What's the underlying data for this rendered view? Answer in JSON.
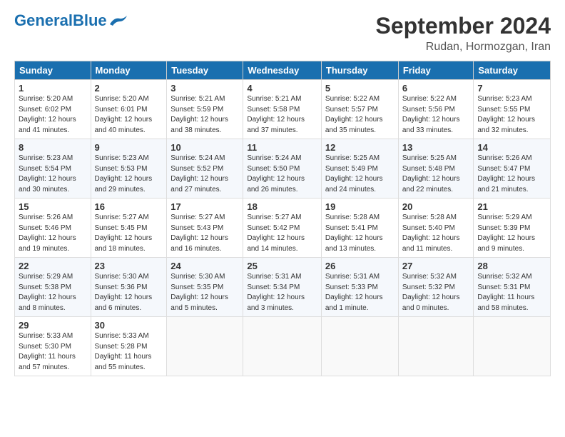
{
  "logo": {
    "text_general": "General",
    "text_blue": "Blue"
  },
  "header": {
    "month": "September 2024",
    "location": "Rudan, Hormozgan, Iran"
  },
  "weekdays": [
    "Sunday",
    "Monday",
    "Tuesday",
    "Wednesday",
    "Thursday",
    "Friday",
    "Saturday"
  ],
  "weeks": [
    [
      {
        "day": "1",
        "info": "Sunrise: 5:20 AM\nSunset: 6:02 PM\nDaylight: 12 hours\nand 41 minutes."
      },
      {
        "day": "2",
        "info": "Sunrise: 5:20 AM\nSunset: 6:01 PM\nDaylight: 12 hours\nand 40 minutes."
      },
      {
        "day": "3",
        "info": "Sunrise: 5:21 AM\nSunset: 5:59 PM\nDaylight: 12 hours\nand 38 minutes."
      },
      {
        "day": "4",
        "info": "Sunrise: 5:21 AM\nSunset: 5:58 PM\nDaylight: 12 hours\nand 37 minutes."
      },
      {
        "day": "5",
        "info": "Sunrise: 5:22 AM\nSunset: 5:57 PM\nDaylight: 12 hours\nand 35 minutes."
      },
      {
        "day": "6",
        "info": "Sunrise: 5:22 AM\nSunset: 5:56 PM\nDaylight: 12 hours\nand 33 minutes."
      },
      {
        "day": "7",
        "info": "Sunrise: 5:23 AM\nSunset: 5:55 PM\nDaylight: 12 hours\nand 32 minutes."
      }
    ],
    [
      {
        "day": "8",
        "info": "Sunrise: 5:23 AM\nSunset: 5:54 PM\nDaylight: 12 hours\nand 30 minutes."
      },
      {
        "day": "9",
        "info": "Sunrise: 5:23 AM\nSunset: 5:53 PM\nDaylight: 12 hours\nand 29 minutes."
      },
      {
        "day": "10",
        "info": "Sunrise: 5:24 AM\nSunset: 5:52 PM\nDaylight: 12 hours\nand 27 minutes."
      },
      {
        "day": "11",
        "info": "Sunrise: 5:24 AM\nSunset: 5:50 PM\nDaylight: 12 hours\nand 26 minutes."
      },
      {
        "day": "12",
        "info": "Sunrise: 5:25 AM\nSunset: 5:49 PM\nDaylight: 12 hours\nand 24 minutes."
      },
      {
        "day": "13",
        "info": "Sunrise: 5:25 AM\nSunset: 5:48 PM\nDaylight: 12 hours\nand 22 minutes."
      },
      {
        "day": "14",
        "info": "Sunrise: 5:26 AM\nSunset: 5:47 PM\nDaylight: 12 hours\nand 21 minutes."
      }
    ],
    [
      {
        "day": "15",
        "info": "Sunrise: 5:26 AM\nSunset: 5:46 PM\nDaylight: 12 hours\nand 19 minutes."
      },
      {
        "day": "16",
        "info": "Sunrise: 5:27 AM\nSunset: 5:45 PM\nDaylight: 12 hours\nand 18 minutes."
      },
      {
        "day": "17",
        "info": "Sunrise: 5:27 AM\nSunset: 5:43 PM\nDaylight: 12 hours\nand 16 minutes."
      },
      {
        "day": "18",
        "info": "Sunrise: 5:27 AM\nSunset: 5:42 PM\nDaylight: 12 hours\nand 14 minutes."
      },
      {
        "day": "19",
        "info": "Sunrise: 5:28 AM\nSunset: 5:41 PM\nDaylight: 12 hours\nand 13 minutes."
      },
      {
        "day": "20",
        "info": "Sunrise: 5:28 AM\nSunset: 5:40 PM\nDaylight: 12 hours\nand 11 minutes."
      },
      {
        "day": "21",
        "info": "Sunrise: 5:29 AM\nSunset: 5:39 PM\nDaylight: 12 hours\nand 9 minutes."
      }
    ],
    [
      {
        "day": "22",
        "info": "Sunrise: 5:29 AM\nSunset: 5:38 PM\nDaylight: 12 hours\nand 8 minutes."
      },
      {
        "day": "23",
        "info": "Sunrise: 5:30 AM\nSunset: 5:36 PM\nDaylight: 12 hours\nand 6 minutes."
      },
      {
        "day": "24",
        "info": "Sunrise: 5:30 AM\nSunset: 5:35 PM\nDaylight: 12 hours\nand 5 minutes."
      },
      {
        "day": "25",
        "info": "Sunrise: 5:31 AM\nSunset: 5:34 PM\nDaylight: 12 hours\nand 3 minutes."
      },
      {
        "day": "26",
        "info": "Sunrise: 5:31 AM\nSunset: 5:33 PM\nDaylight: 12 hours\nand 1 minute."
      },
      {
        "day": "27",
        "info": "Sunrise: 5:32 AM\nSunset: 5:32 PM\nDaylight: 12 hours\nand 0 minutes."
      },
      {
        "day": "28",
        "info": "Sunrise: 5:32 AM\nSunset: 5:31 PM\nDaylight: 11 hours\nand 58 minutes."
      }
    ],
    [
      {
        "day": "29",
        "info": "Sunrise: 5:33 AM\nSunset: 5:30 PM\nDaylight: 11 hours\nand 57 minutes."
      },
      {
        "day": "30",
        "info": "Sunrise: 5:33 AM\nSunset: 5:28 PM\nDaylight: 11 hours\nand 55 minutes."
      },
      {
        "day": "",
        "info": ""
      },
      {
        "day": "",
        "info": ""
      },
      {
        "day": "",
        "info": ""
      },
      {
        "day": "",
        "info": ""
      },
      {
        "day": "",
        "info": ""
      }
    ]
  ]
}
